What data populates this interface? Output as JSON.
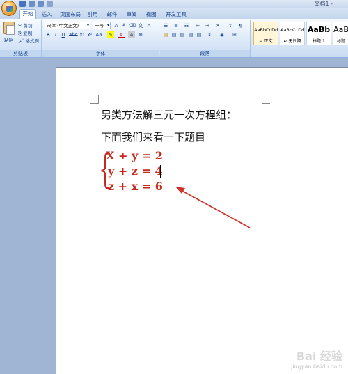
{
  "window": {
    "title": "文档1 - "
  },
  "tabs": [
    "开始",
    "插入",
    "页面布局",
    "引用",
    "邮件",
    "审阅",
    "视图",
    "开发工具"
  ],
  "active_tab": "开始",
  "clipboard": {
    "paste": "粘贴",
    "cut": "剪切",
    "copy": "复制",
    "format_painter": "格式刷",
    "label": "剪贴板"
  },
  "font": {
    "name": "宋体 (中文正文)",
    "size": "一号",
    "label": "字体"
  },
  "paragraph": {
    "label": "段落"
  },
  "styles": [
    {
      "sample": "AaBbCcDd",
      "name": "↵ 正文",
      "selected": true
    },
    {
      "sample": "AaBbCcDd",
      "name": "↵ 无间隔",
      "selected": false
    },
    {
      "sample": "AaBb",
      "name": "标题 1",
      "selected": false
    },
    {
      "sample": "AaB",
      "name": "标题",
      "selected": false
    }
  ],
  "document": {
    "line1": "另类方法解三元一次方程组：",
    "line2": "下面我们来看一下题目",
    "brace": "{",
    "equations": [
      "X + y = 2",
      "y + z = 4",
      "z + x = 6"
    ]
  },
  "watermark": {
    "logo": "Bai 经验",
    "url": "jingyan.baidu.com"
  },
  "colors": {
    "equation": "#c62a1e",
    "arrow": "#d0322a",
    "ribbon": "#dbe8f8",
    "doc_bg": "#9fb5d3"
  }
}
